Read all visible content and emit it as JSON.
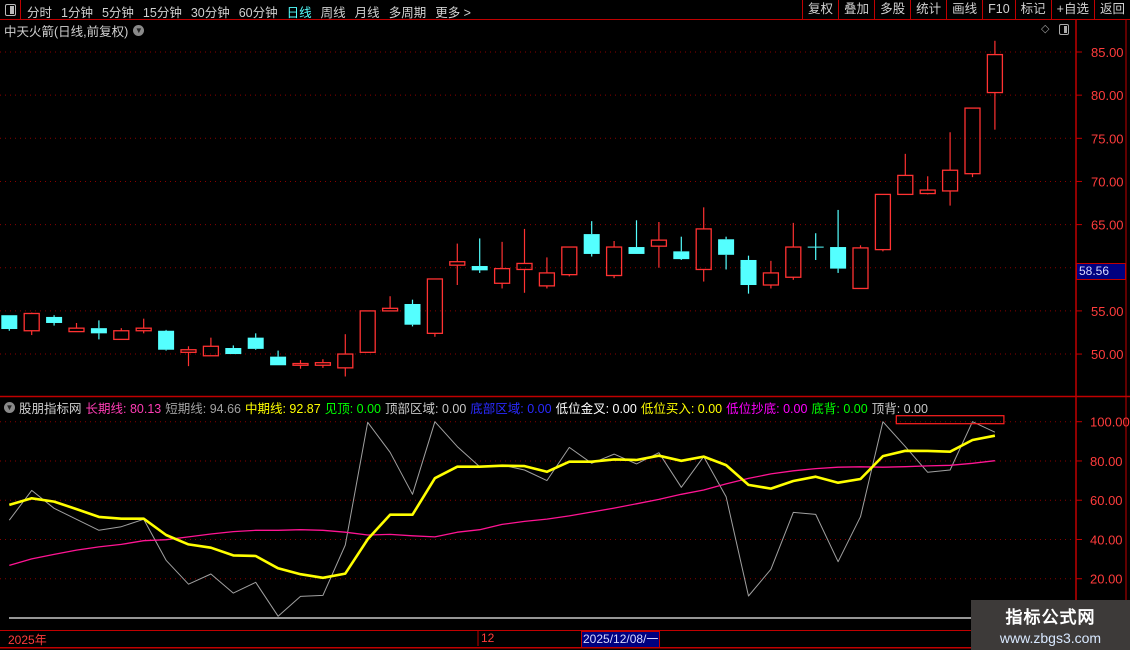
{
  "toolbar": {
    "periods": [
      "分时",
      "1分钟",
      "5分钟",
      "15分钟",
      "30分钟",
      "60分钟",
      "日线",
      "周线",
      "月线",
      "多周期",
      "更多 >"
    ],
    "active_period": "日线",
    "buttons": [
      "复权",
      "叠加",
      "多股",
      "统计",
      "画线",
      "F10",
      "标记",
      "+自选",
      "返回"
    ]
  },
  "main_panel": {
    "title": "中天火箭(日线,前复权)",
    "price_axis_labels": [
      "85.00",
      "80.00",
      "75.00",
      "70.00",
      "65.00",
      "60.00",
      "55.00",
      "50.00"
    ],
    "current_price_tag": "58.56"
  },
  "indicator_panel": {
    "name": "股朋指标网",
    "items": [
      {
        "label": "长期线: 80.13",
        "color": "#ff3cb4"
      },
      {
        "label": "短期线: 94.66",
        "color": "#a0a0a0"
      },
      {
        "label": "中期线: 92.87",
        "color": "#ffff00"
      },
      {
        "label": "见顶: 0.00",
        "color": "#00ff00"
      },
      {
        "label": "顶部区域: 0.00",
        "color": "#c8c8c8"
      },
      {
        "label": "底部区域: 0.00",
        "color": "#2a2aff"
      },
      {
        "label": "低位金叉: 0.00",
        "color": "#ffffff"
      },
      {
        "label": "低位买入: 0.00",
        "color": "#ffff00"
      },
      {
        "label": "低位抄底: 0.00",
        "color": "#ff00ff"
      },
      {
        "label": "底背: 0.00",
        "color": "#00ff00"
      },
      {
        "label": "顶背: 0.00",
        "color": "#c8c8c8"
      }
    ],
    "axis_labels": [
      "100.00",
      "80.00",
      "60.00",
      "40.00",
      "20.00"
    ]
  },
  "time_axis": {
    "year_label": "2025年",
    "month_label": "12",
    "cursor_date": "2025/12/08/一"
  },
  "watermark": {
    "line1": "指标公式网",
    "line2": "www.zbgs3.com"
  },
  "colors": {
    "up": "#ff3232",
    "down": "#54ffff",
    "grid": "#8b0000",
    "axis": "#c00000",
    "long": "#ff1493",
    "short": "#a0a0a0",
    "mid": "#ffff00"
  },
  "chart_data": [
    {
      "type": "candlestick",
      "title": "中天火箭(日线,前复权)",
      "ylim": [
        46,
        87
      ],
      "ohlc": [
        [
          54.5,
          54.5,
          52.7,
          52.9
        ],
        [
          52.7,
          54.8,
          52.2,
          54.7
        ],
        [
          54.3,
          54.5,
          53.3,
          53.6
        ],
        [
          52.6,
          53.6,
          52.6,
          53.0
        ],
        [
          53.0,
          53.9,
          51.7,
          52.4
        ],
        [
          51.7,
          53.0,
          51.7,
          52.7
        ],
        [
          52.7,
          54.1,
          52.4,
          53.0
        ],
        [
          52.7,
          52.8,
          50.4,
          50.5
        ],
        [
          50.2,
          50.9,
          48.6,
          50.5
        ],
        [
          49.8,
          51.9,
          49.8,
          50.9
        ],
        [
          50.7,
          51.0,
          50.0,
          50.0
        ],
        [
          51.9,
          52.4,
          50.5,
          50.6
        ],
        [
          49.7,
          50.4,
          48.7,
          48.7
        ],
        [
          48.7,
          49.3,
          48.3,
          48.9
        ],
        [
          48.7,
          49.4,
          48.4,
          49.0
        ],
        [
          48.4,
          52.3,
          47.4,
          50.0
        ],
        [
          50.2,
          55.0,
          50.2,
          55.0
        ],
        [
          55.0,
          56.7,
          55.0,
          55.3
        ],
        [
          55.8,
          56.3,
          53.2,
          53.4
        ],
        [
          52.4,
          58.7,
          52.0,
          58.7
        ],
        [
          60.3,
          62.8,
          58.0,
          60.7
        ],
        [
          60.2,
          63.4,
          59.4,
          59.7
        ],
        [
          58.2,
          63.0,
          57.6,
          59.9
        ],
        [
          59.8,
          64.5,
          57.1,
          60.5
        ],
        [
          57.9,
          61.2,
          57.6,
          59.4
        ],
        [
          59.2,
          62.4,
          59.0,
          62.4
        ],
        [
          63.9,
          65.4,
          61.3,
          61.6
        ],
        [
          59.1,
          63.1,
          58.8,
          62.4
        ],
        [
          62.4,
          65.5,
          61.6,
          61.6
        ],
        [
          62.5,
          65.3,
          60.0,
          63.2
        ],
        [
          61.9,
          63.6,
          60.9,
          61.0
        ],
        [
          59.8,
          67.0,
          58.4,
          64.5
        ],
        [
          63.3,
          63.6,
          59.8,
          61.5
        ],
        [
          60.9,
          61.4,
          57.0,
          58.0
        ],
        [
          58.0,
          60.8,
          57.6,
          59.4
        ],
        [
          58.9,
          65.2,
          58.6,
          62.4
        ],
        [
          62.45,
          64.0,
          60.9,
          62.4
        ],
        [
          62.4,
          66.7,
          59.4,
          59.9
        ],
        [
          57.6,
          62.6,
          57.6,
          62.3
        ],
        [
          62.1,
          68.5,
          61.9,
          68.5
        ],
        [
          68.5,
          73.2,
          68.5,
          70.7
        ],
        [
          68.6,
          70.6,
          68.5,
          69.0
        ],
        [
          68.9,
          75.7,
          67.2,
          71.3
        ],
        [
          70.9,
          78.5,
          70.5,
          78.5
        ],
        [
          80.3,
          86.3,
          76.0,
          84.7
        ]
      ]
    },
    {
      "type": "line",
      "title": "股朋指标网",
      "ylim": [
        0,
        100
      ],
      "series": [
        {
          "name": "长期线",
          "values": [
            26.8,
            30.1,
            32.4,
            34.6,
            36.2,
            37.5,
            39.4,
            39.9,
            41.3,
            42.8,
            44.0,
            44.7,
            44.7,
            45.0,
            44.7,
            43.7,
            42.3,
            42.6,
            41.9,
            41.3,
            43.7,
            45.0,
            47.7,
            49.2,
            50.4,
            52.0,
            54.0,
            56.0,
            58.2,
            60.4,
            63.0,
            65.2,
            68.3,
            71.1,
            73.4,
            75.0,
            76.1,
            76.8,
            77.0,
            76.8,
            77.1,
            77.5,
            77.8,
            78.8,
            80.13
          ]
        },
        {
          "name": "短期线",
          "values": [
            49.8,
            65.0,
            55.9,
            50.3,
            44.7,
            46.5,
            50.3,
            29.4,
            17.2,
            22.4,
            12.7,
            18.2,
            0.9,
            11.0,
            11.5,
            37.2,
            99.7,
            84.4,
            63.0,
            100,
            87.3,
            77.1,
            77.9,
            75.4,
            70.0,
            86.9,
            78.8,
            83.5,
            78.5,
            84.2,
            66.6,
            82.2,
            61.8,
            11.2,
            24.8,
            53.8,
            52.8,
            28.7,
            51.6,
            100,
            87.3,
            74.2,
            75.4,
            100,
            94.66
          ]
        },
        {
          "name": "中期线",
          "values": [
            57.6,
            61.0,
            59.3,
            55.5,
            51.5,
            50.6,
            50.6,
            42.3,
            37.5,
            35.8,
            31.9,
            31.6,
            25.3,
            22.3,
            20.5,
            22.6,
            40.1,
            52.6,
            52.6,
            71.2,
            77.1,
            77.1,
            77.6,
            77.4,
            74.5,
            79.6,
            79.6,
            80.8,
            80.5,
            82.7,
            80.1,
            82.2,
            77.9,
            67.8,
            65.9,
            69.8,
            72.0,
            68.9,
            70.8,
            82.5,
            85.2,
            85.1,
            84.7,
            90.7,
            92.87
          ]
        }
      ],
      "top_zone_marker": {
        "from_bar": 40,
        "to_bar": 44,
        "level": 100
      }
    }
  ]
}
